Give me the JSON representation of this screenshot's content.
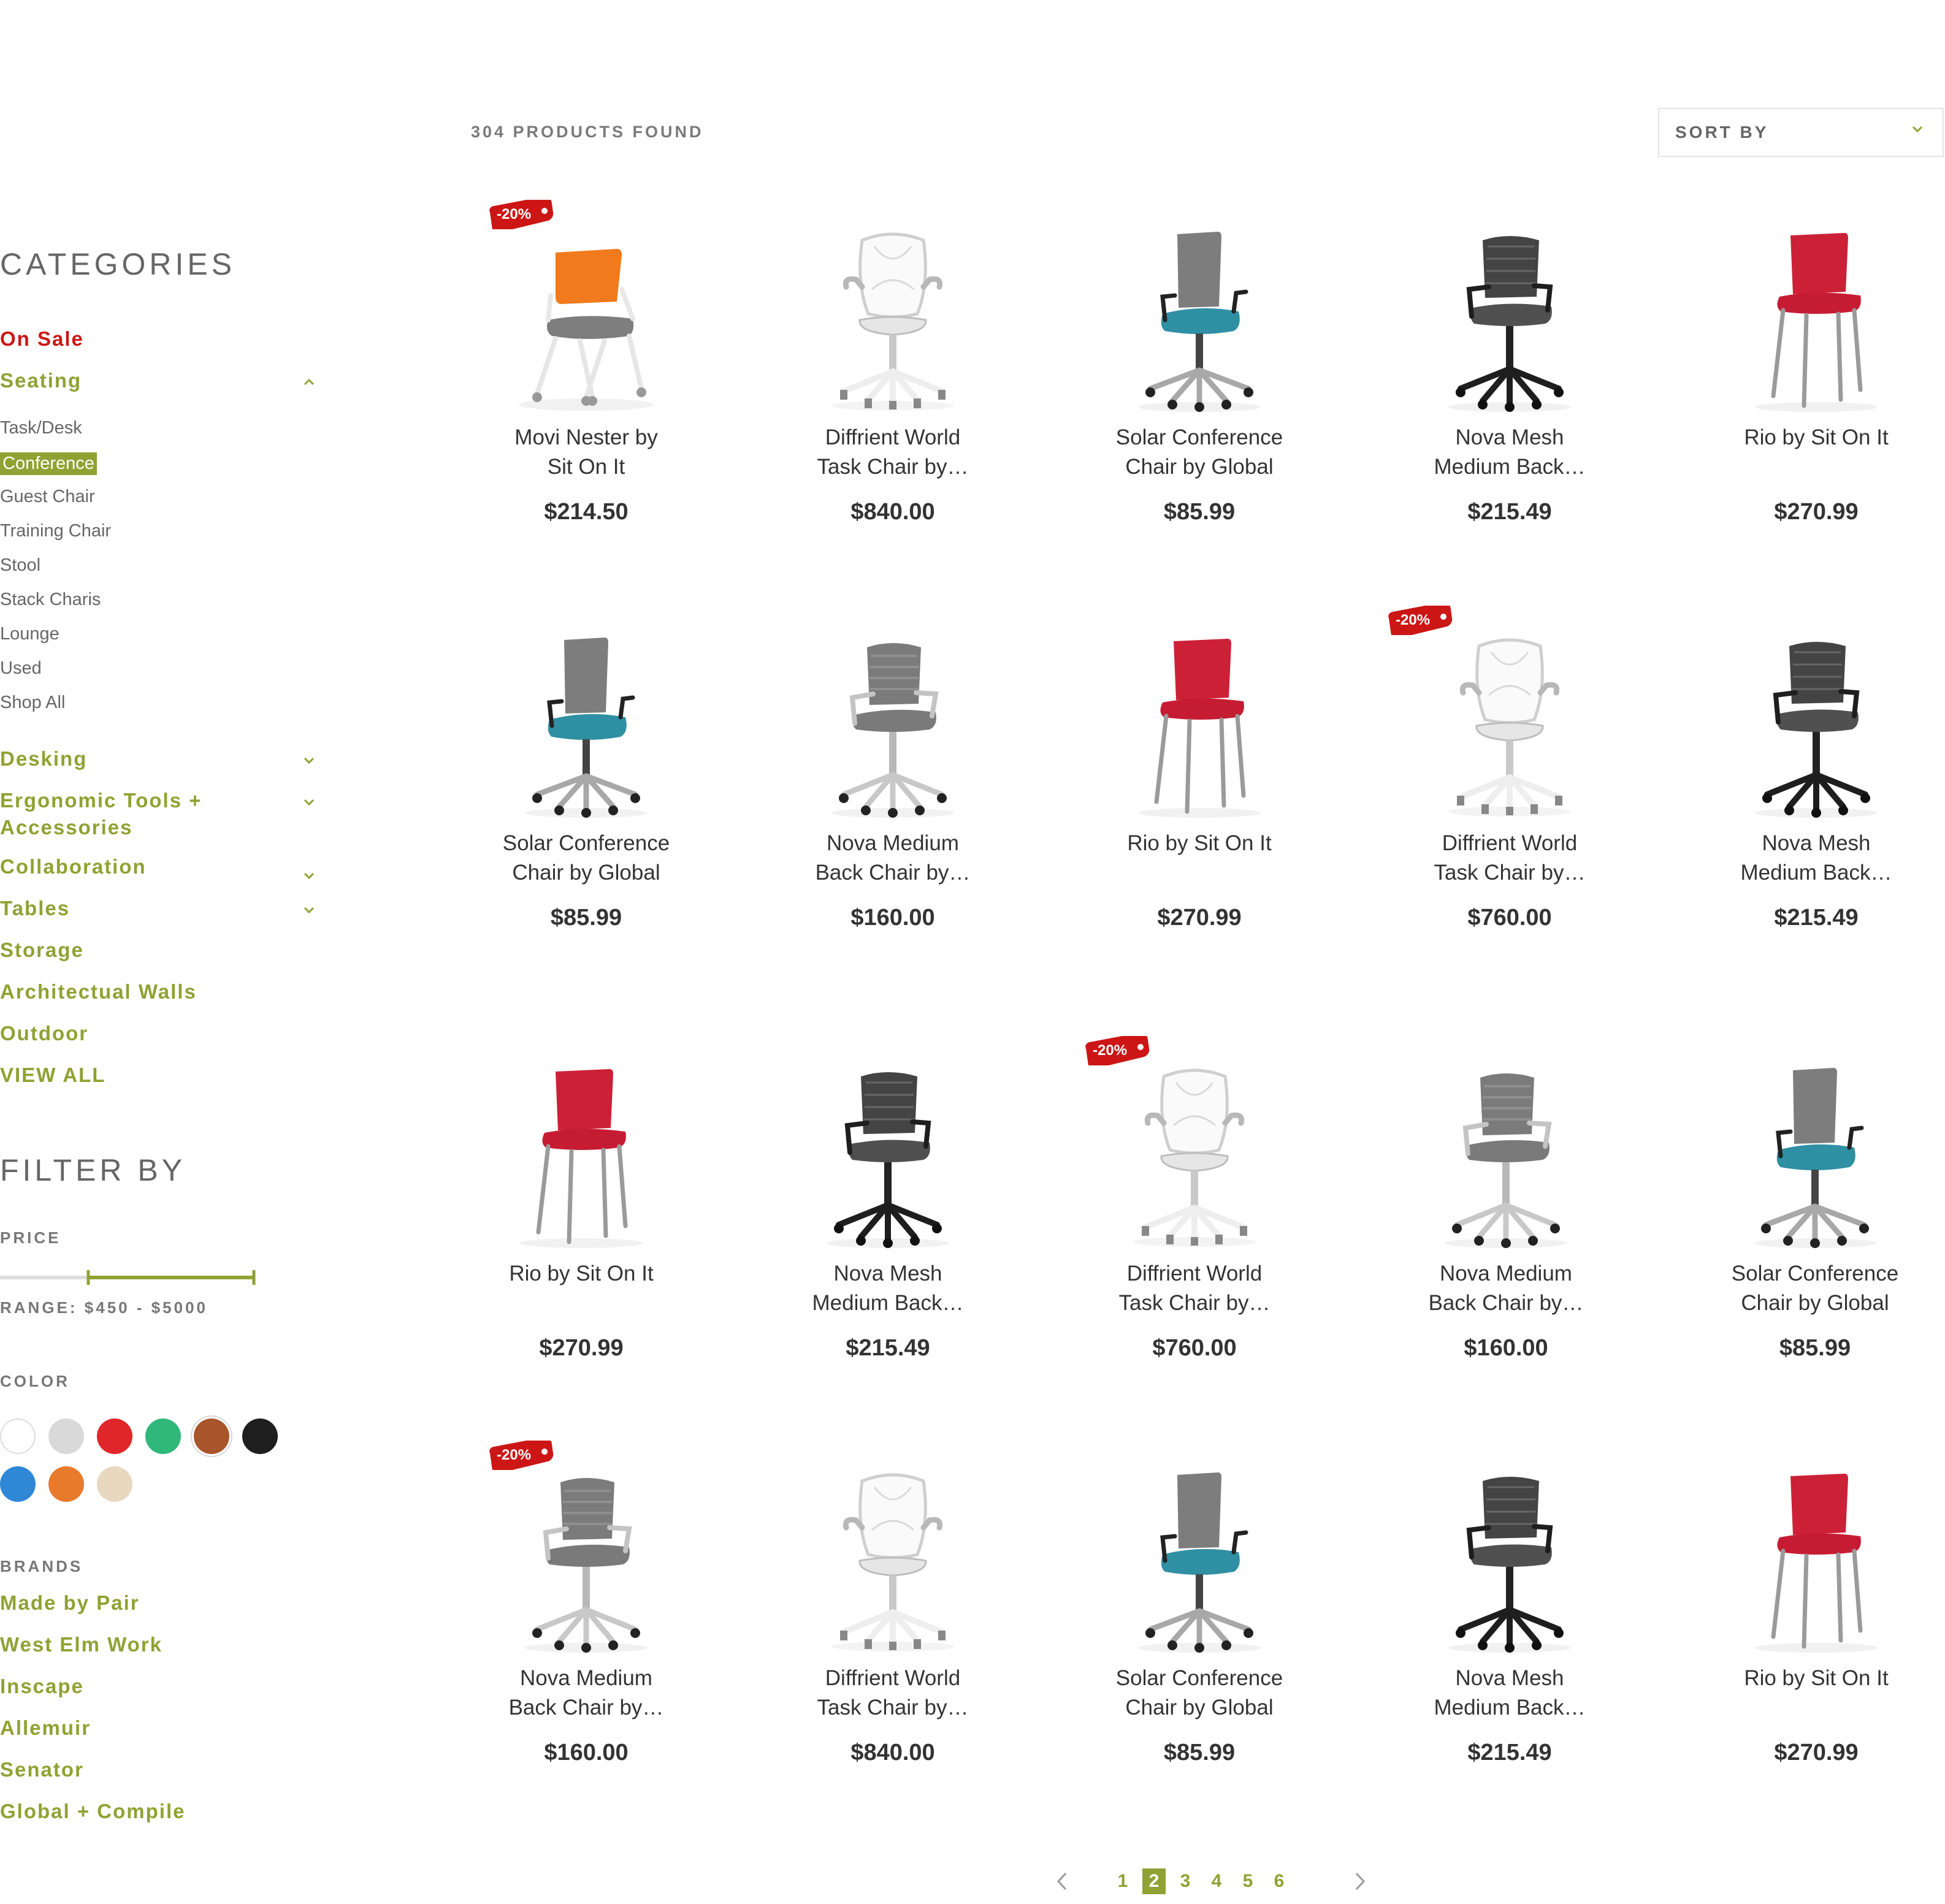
{
  "header": {
    "products_found": "304 PRODUCTS FOUND",
    "sort_label": "SORT BY"
  },
  "sidebar": {
    "categories_title": "CATEGORIES",
    "on_sale": "On Sale",
    "seating": "Seating",
    "seating_subs": [
      "Task/Desk",
      "Conference",
      "Guest Chair",
      "Training Chair",
      "Stool",
      "Stack Charis",
      "Lounge",
      "Used",
      "Shop All"
    ],
    "active_sub": "Conference",
    "categories": [
      {
        "label": "Desking",
        "expandable": true
      },
      {
        "label": "Ergonomic Tools +\nAccessories",
        "expandable": true
      },
      {
        "label": "Collaboration",
        "expandable": true
      },
      {
        "label": "Tables",
        "expandable": true
      },
      {
        "label": "Storage",
        "expandable": false
      },
      {
        "label": "Architectual Walls",
        "expandable": false
      },
      {
        "label": "Outdoor",
        "expandable": false
      },
      {
        "label": "VIEW ALL",
        "expandable": false
      }
    ],
    "filter_title": "FILTER BY",
    "price_label": "PRICE",
    "price_range": "RANGE: $450 - $5000",
    "color_label": "COLOR",
    "colors": [
      "#ffffff",
      "#d9d9d9",
      "#e0262b",
      "#2fb87a",
      "#a8552b",
      "#1e1e1e",
      "#2f88d6",
      "#e87a2c",
      "#e8d8c0"
    ],
    "selected_color": "#a8552b",
    "brands_label": "BRANDS",
    "brands": [
      "Made by Pair",
      "West Elm Work",
      "Inscape",
      "Allemuir",
      "Senator",
      "Global + Compile"
    ]
  },
  "products": [
    {
      "name": "Movi Nester by\nSit On It",
      "price": "$214.50",
      "type": "movi",
      "sale": "-20%"
    },
    {
      "name": "Diffrient World\nTask Chair by…",
      "price": "$840.00",
      "type": "diffrient",
      "sale": ""
    },
    {
      "name": "Solar Conference\nChair by Global",
      "price": "$85.99",
      "type": "solar",
      "sale": ""
    },
    {
      "name": "Nova Mesh\nMedium Back…",
      "price": "$215.49",
      "type": "novamesh",
      "sale": ""
    },
    {
      "name": "Rio by Sit On It",
      "price": "$270.99",
      "type": "rio",
      "sale": ""
    },
    {
      "name": "Solar Conference\nChair by Global",
      "price": "$85.99",
      "type": "solar",
      "sale": ""
    },
    {
      "name": "Nova Medium\nBack Chair by…",
      "price": "$160.00",
      "type": "novamed",
      "sale": ""
    },
    {
      "name": "Rio by Sit On It",
      "price": "$270.99",
      "type": "rio",
      "sale": ""
    },
    {
      "name": "Diffrient World\nTask Chair by…",
      "price": "$760.00",
      "type": "diffrient",
      "sale": "-20%"
    },
    {
      "name": "Nova Mesh\nMedium Back…",
      "price": "$215.49",
      "type": "novamesh",
      "sale": ""
    },
    {
      "name": "Rio by Sit On It",
      "price": "$270.99",
      "type": "rio",
      "sale": ""
    },
    {
      "name": "Nova Mesh\nMedium Back…",
      "price": "$215.49",
      "type": "novamesh",
      "sale": ""
    },
    {
      "name": "Diffrient World\nTask Chair by…",
      "price": "$760.00",
      "type": "diffrient",
      "sale": "-20%"
    },
    {
      "name": "Nova Medium\nBack Chair by…",
      "price": "$160.00",
      "type": "novamed",
      "sale": ""
    },
    {
      "name": "Solar Conference\nChair by Global",
      "price": "$85.99",
      "type": "solar",
      "sale": ""
    },
    {
      "name": "Nova Medium\nBack Chair by…",
      "price": "$160.00",
      "type": "novamed",
      "sale": "-20%"
    },
    {
      "name": "Diffrient World\nTask Chair by…",
      "price": "$840.00",
      "type": "diffrient",
      "sale": ""
    },
    {
      "name": "Solar Conference\nChair by Global",
      "price": "$85.99",
      "type": "solar",
      "sale": ""
    },
    {
      "name": "Nova Mesh\nMedium Back…",
      "price": "$215.49",
      "type": "novamesh",
      "sale": ""
    },
    {
      "name": "Rio by Sit On It",
      "price": "$270.99",
      "type": "rio",
      "sale": ""
    }
  ],
  "pagination": {
    "pages": [
      "1",
      "2",
      "3",
      "4",
      "5",
      "6"
    ],
    "current": "2"
  },
  "theme": {
    "accent": "#8fa233",
    "sale": "#cc1616"
  }
}
